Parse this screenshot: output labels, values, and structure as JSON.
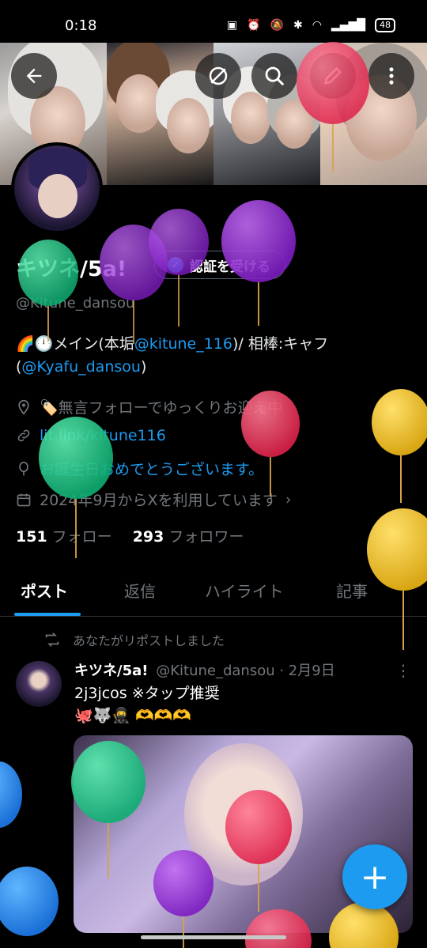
{
  "status_bar": {
    "time": "0:18",
    "battery": "48"
  },
  "profile": {
    "name": "キツネ/5a!",
    "handle": "@Kitune_dansou",
    "verify_button": "認証を受ける",
    "bio_prefix": "🌈🕛メイン(本垢",
    "bio_main_account": "@kitune_116",
    "bio_middle": ")/ 相棒:キャフ",
    "bio_open": "(",
    "bio_partner": "@Kyafu_dansou",
    "bio_close": ")",
    "location": "🏷️無言フォローでゆっくりお迎え中",
    "website": "lit.link/kitune116",
    "birthday": "お誕生日おめでとうございます。",
    "joined": "2024年9月からXを利用しています",
    "following_count": "151",
    "following_label": "フォロー",
    "followers_count": "293",
    "followers_label": "フォロワー"
  },
  "tabs": [
    "ポスト",
    "返信",
    "ハイライト",
    "記事"
  ],
  "post": {
    "repost_note": "あなたがリポストしました",
    "author_name": "キツネ/5a!",
    "author_handle": "@Kitune_dansou",
    "date": "· 2月9日",
    "line1": "2j3jcos ※タップ推奨",
    "line2": "🐙🐺🥷 🫶🫶🫶"
  },
  "icons": {
    "back": "back-arrow-icon",
    "hide": "eye-slash-icon",
    "search": "search-icon",
    "edit": "pencil-icon",
    "more": "more-vertical-icon",
    "compose": "plus-icon"
  },
  "colors": {
    "accent": "#1d9bf0",
    "background": "#000000",
    "muted": "#71767b"
  }
}
